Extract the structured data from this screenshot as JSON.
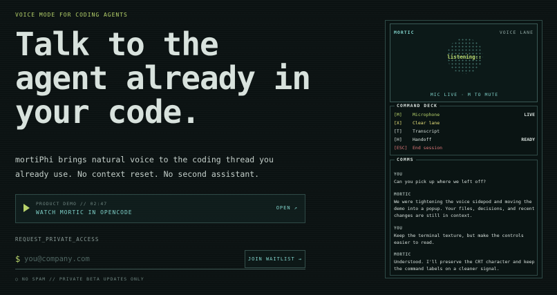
{
  "hero": {
    "eyebrow": "VOICE MODE FOR CODING AGENTS",
    "headline_lines": [
      "Talk to the",
      "agent already in",
      "your code."
    ],
    "subtitle": "mortiPhi brings natural voice to the coding thread you already use. No context reset. No second assistant."
  },
  "demo": {
    "meta": "PRODUCT DEMO // 02:47",
    "title": "WATCH MORTIC IN OPENCODE",
    "open_label": "OPEN ↗"
  },
  "waitlist": {
    "label": "REQUEST_PRIVATE_ACCESS",
    "prompt": "$",
    "placeholder": "you@company.com",
    "button": "JOIN WAITLIST →",
    "fineprint": "○ NO SPAM // PRIVATE BETA UPDATES ONLY"
  },
  "panel": {
    "agent_name": "MORTIC",
    "lane_label": "VOICE LANE",
    "status": "listening::",
    "mic_status": "MIC LIVE · M TO MUTE",
    "deck_title": "COMMAND DECK",
    "commands": [
      {
        "key": "[M]",
        "label": "Microphone",
        "state": "LIVE",
        "color": "#b7d36b"
      },
      {
        "key": "[X]",
        "label": "Clear lane",
        "state": "",
        "color": "#e6e07a"
      },
      {
        "key": "[T]",
        "label": "Transcript",
        "state": "",
        "color": "#d7e0dc"
      },
      {
        "key": "[H]",
        "label": "Handoff",
        "state": "READY",
        "color": "#d7e0dc"
      },
      {
        "key": "[ESC]",
        "label": "End session",
        "state": "",
        "color": "#e0787a"
      }
    ],
    "comms_title": "COMMS",
    "messages": [
      {
        "who": "YOU",
        "text": "Can you pick up where we left off?"
      },
      {
        "who": "MORTIC",
        "text": "We were tightening the voice sidepod and moving the demo into a popup. Your files, decisions, and recent changes are still in context."
      },
      {
        "who": "YOU",
        "text": "Keep the terminal texture, but make the controls easier to read."
      },
      {
        "who": "MORTIC",
        "text": "Understood. I'll preserve the CRT character and keep the command labels on a cleaner signal."
      }
    ]
  },
  "colors": {
    "accent": "#b7d36b",
    "cyan": "#7fd0c8",
    "background": "#0b1212"
  }
}
